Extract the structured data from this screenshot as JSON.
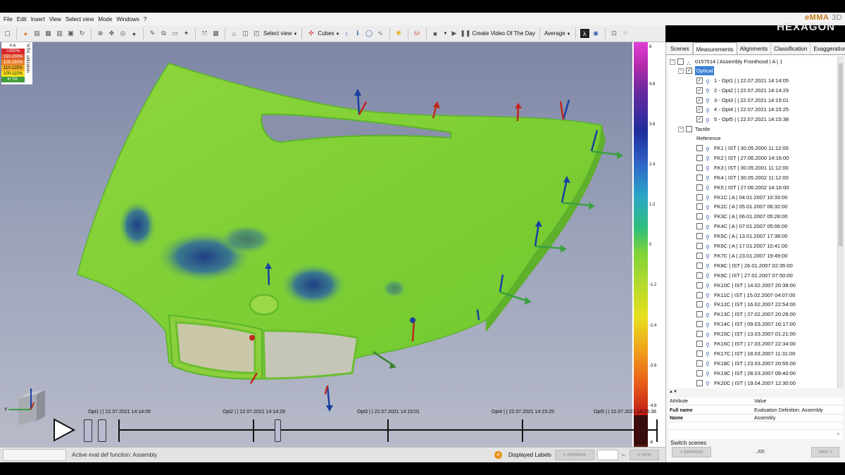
{
  "menu": [
    "File",
    "Edit",
    "Insert",
    "View",
    "Select view",
    "Mode",
    "Windows",
    "?"
  ],
  "brand": {
    "name": "eMMA",
    "suffix": "3D",
    "logo_text": "HEXAGON"
  },
  "toolbar": {
    "select_view": "Select view",
    "cubes": "Cubes",
    "create_video": "Create Video Of The Day",
    "average": "Average"
  },
  "tolerance_legend": {
    "title": "%Tol. utilization",
    "rows": [
      {
        "label": "n.a.",
        "color": "#ffffff",
        "text_color": "#111111"
      },
      {
        "label": ">200%",
        "color": "#d8262a",
        "text_color": "#ffffff"
      },
      {
        "label": "150-200%",
        "color": "#e2572e",
        "text_color": "#ffffff"
      },
      {
        "label": "125-150%",
        "color": "#e9812c",
        "text_color": "#ffffff"
      },
      {
        "label": "110-125%",
        "color": "#f0ad23",
        "text_color": "#111111"
      },
      {
        "label": "100-110%",
        "color": "#f5e21e",
        "text_color": "#111111"
      },
      {
        "label": "in Tol.",
        "color": "#3e9b3a",
        "text_color": "#ffffff"
      }
    ]
  },
  "color_scale": {
    "ticks": [
      "6",
      "4.8",
      "3.6",
      "2.4",
      "1.2",
      "0",
      "-1.2",
      "-2.4",
      "-3.6",
      "-4.8",
      "-6"
    ]
  },
  "timeline": {
    "labels": [
      "Opt1 | | 22.07.2021 14:14:05",
      "Opt2 | | 22.07.2021 14:14:29",
      "Opt3 | | 22.07.2021 14:15:01",
      "Opt4 | | 22.07.2021 14:15:25",
      "Opt5 | | 22.07.2021 14:15:38"
    ]
  },
  "status": {
    "message": "Active eval def function: Assembly",
    "displayed_labels": "Displayed Labels",
    "previous": "« previous",
    "next": "» next",
    "dash": "–"
  },
  "panel": {
    "tabs": [
      "Scenes",
      "Measurements",
      "Alignments",
      "Classification",
      "Exaggeration"
    ],
    "active_tab": "Measurements",
    "root": "0157514 | Assembly Fronthood | A | 1",
    "optical": "Optical",
    "optical_items": [
      "1 - Opt1 | | 22.07.2021 14:14:05",
      "2 - Opt2 | | 22.07.2021 14:14:29",
      "3 - Opt3 | | 22.07.2021 14:15:01",
      "4 - Opt4 | | 22.07.2021 14:15:25",
      "5 - Opt5 | | 22.07.2021 14:15:38"
    ],
    "tactile": "Tactile",
    "reference": "Reference",
    "tactile_items": [
      "FK1 | IST | 30.05.2000 11:12:00",
      "FK2 | IST | 27.06.2000 14:16:00",
      "FK3 | IST | 30.05.2001 11:12:00",
      "FK4 | IST | 30.05.2002 11:12:00",
      "FK5 | IST | 27.06.2002 14:16:00",
      "FK1C | A | 04.01.2007 10:33:00",
      "FK2C | A | 05.01.2007 06:32:00",
      "FK3C | A | 06.01.2007 05:28:00",
      "FK4C | A | 07.01.2007 05:06:00",
      "FK5C | A | 13.01.2007 17:38:00",
      "FK6C | A | 17.01.2007 10:41:00",
      "FK7C | A | 23.01.2007 19:49:00",
      "FK8C | IST | 26.01.2007 02:35:00",
      "FK9C | IST | 27.01.2007 07:50:00",
      "FK10C | IST | 14.02.2007 20:38:00",
      "FK11C | IST | 15.02.2007 04:07:00",
      "FK12C | IST | 16.02.2007 22:54:00",
      "FK13C | IST | 27.02.2007 20:26:00",
      "FK14C | IST | 09.03.2007 16:17:00",
      "FK15C | IST | 13.03.2007 01:21:00",
      "FK16C | IST | 17.03.2007 22:34:00",
      "FK17C | IST | 18.03.2007 11:31:00",
      "FK18C | IST | 23.03.2007 20:55:00",
      "FK19C | IST | 28.03.2007 09:40:00",
      "FK20C | IST | 19.04.2007 12:30:00"
    ],
    "attributes": {
      "header_attribute": "Attribute",
      "header_value": "Value",
      "rows": [
        {
          "key": "Full name",
          "value": "Evaluation Definition: Assembly"
        },
        {
          "key": "Name",
          "value": "Assembly"
        }
      ]
    },
    "switch_scenes": "Switch scenes",
    "previous": "« previous",
    "next": "next »",
    "count": "../00"
  }
}
